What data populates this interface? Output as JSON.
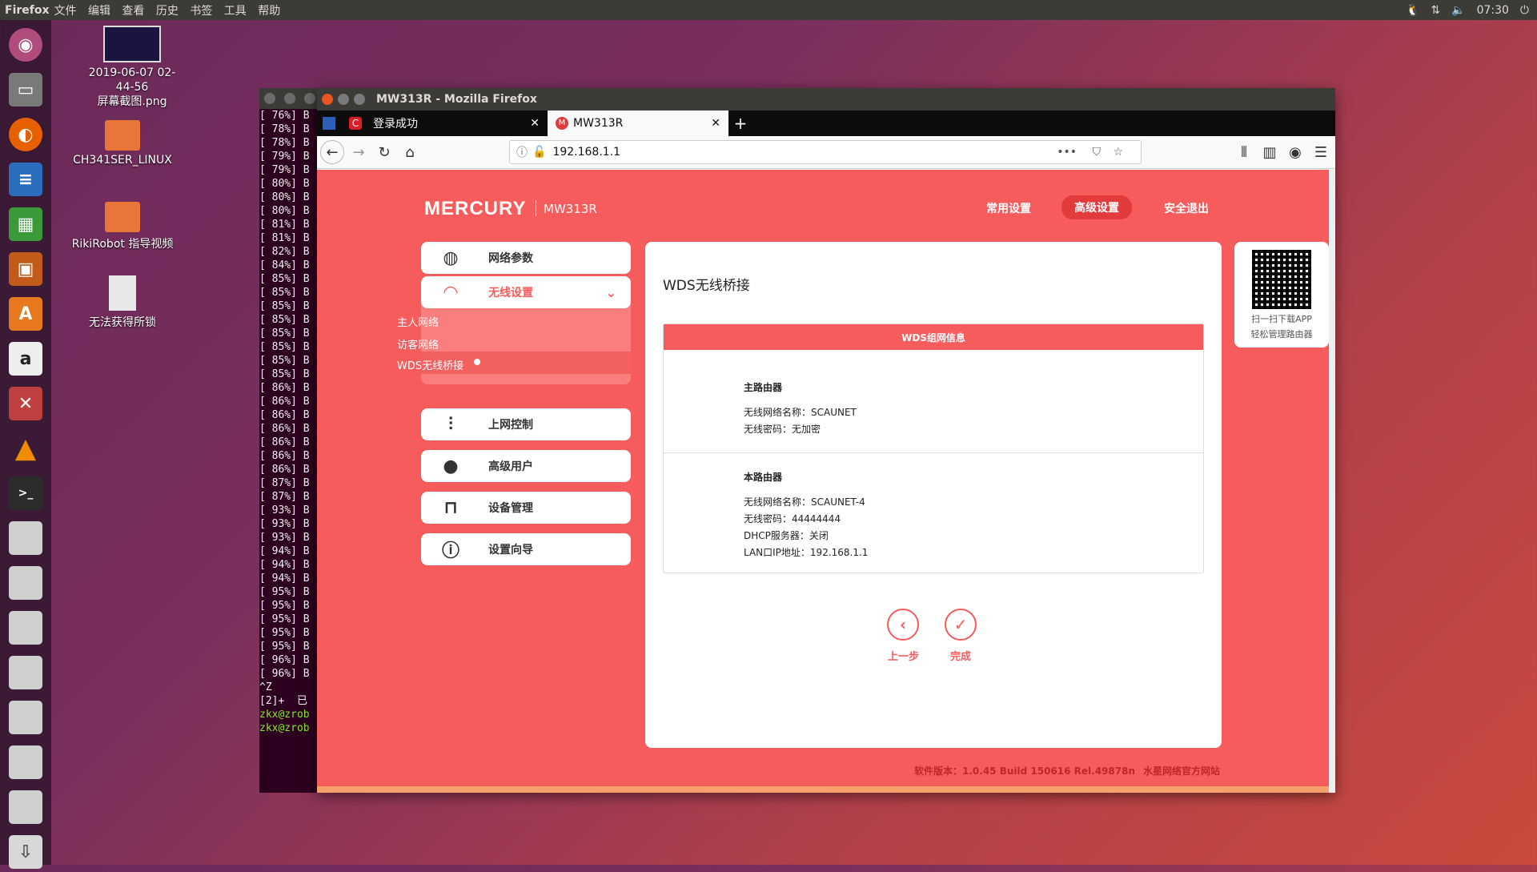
{
  "topbar": {
    "app": "Firefox",
    "menus": [
      "文件",
      "编辑",
      "查看",
      "历史",
      "书签",
      "工具",
      "帮助"
    ],
    "time": "07:30"
  },
  "desktop": {
    "items": [
      {
        "label": "2019-06-07 02-44-56\n屏幕截图.png"
      },
      {
        "label": "CH341SER_LINUX"
      },
      {
        "label": "RikiRobot 指导视频"
      },
      {
        "label": "无法获得所锁"
      }
    ]
  },
  "terminal": {
    "lines": [
      "[ 76%] B",
      "[ 78%] B",
      "[ 78%] B",
      "[ 79%] B",
      "[ 79%] B",
      "[ 80%] B",
      "[ 80%] B",
      "[ 80%] B",
      "[ 81%] B",
      "[ 81%] B",
      "[ 82%] B",
      "[ 84%] B",
      "[ 85%] B",
      "[ 85%] B",
      "[ 85%] B",
      "[ 85%] B",
      "[ 85%] B",
      "[ 85%] B",
      "[ 85%] B",
      "[ 85%] B",
      "[ 86%] B",
      "[ 86%] B",
      "[ 86%] B",
      "[ 86%] B",
      "[ 86%] B",
      "[ 86%] B",
      "[ 86%] B",
      "[ 87%] B",
      "[ 87%] B",
      "[ 93%] B",
      "[ 93%] B",
      "[ 93%] B",
      "[ 94%] B",
      "[ 94%] B",
      "[ 94%] B",
      "[ 95%] B",
      "[ 95%] B",
      "[ 95%] B",
      "[ 95%] B",
      "[ 95%] B",
      "[ 96%] B",
      "[ 96%] B",
      "^Z",
      "[2]+  已",
      "zkx@zrob",
      "zkx@zrob"
    ]
  },
  "firefox": {
    "window_title": "MW313R - Mozilla Firefox",
    "tabs": [
      {
        "label": "登录成功"
      },
      {
        "label": "MW313R"
      }
    ],
    "url": "192.168.1.1"
  },
  "router": {
    "brand": "MERCURY",
    "model": "MW313R",
    "top_links": [
      "常用设置",
      "高级设置",
      "安全退出"
    ],
    "sidebar": [
      {
        "label": "网络参数"
      },
      {
        "label": "无线设置"
      },
      {
        "label": "上网控制"
      },
      {
        "label": "高级用户"
      },
      {
        "label": "设备管理"
      },
      {
        "label": "设置向导"
      }
    ],
    "submenu": [
      "主人网络",
      "访客网络",
      "WDS无线桥接"
    ],
    "page_title": "WDS无线桥接",
    "box_header": "WDS组网信息",
    "main_router": {
      "title": "主路由器",
      "ssid": "无线网络名称：SCAUNET",
      "password": "无线密码：无加密"
    },
    "this_router": {
      "title": "本路由器",
      "ssid": "无线网络名称：SCAUNET-4",
      "password": "无线密码：44444444",
      "dhcp": "DHCP服务器：关闭",
      "lan_ip": "LAN口IP地址：192.168.1.1"
    },
    "prev_label": "上一步",
    "finish_label": "完成",
    "qr_text1": "扫一扫下载APP",
    "qr_text2": "轻松管理路由器",
    "version": "软件版本：1.0.45 Build 150616 Rel.49878n",
    "official_site": "水星网络官方网站"
  }
}
